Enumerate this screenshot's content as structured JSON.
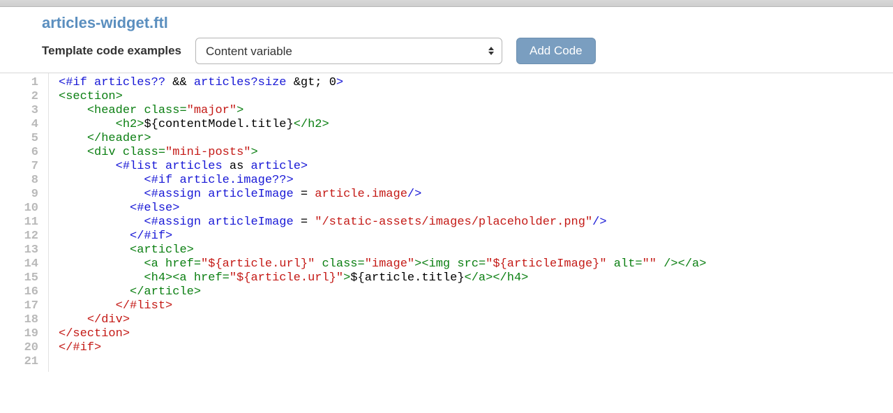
{
  "header": {
    "filename": "articles-widget.ftl",
    "label": "Template code examples",
    "select_value": "Content variable",
    "add_button": "Add Code"
  },
  "code": {
    "line_count": 21,
    "lines": [
      [
        {
          "c": "t-blue",
          "t": "<#if"
        },
        {
          "c": "",
          "t": " "
        },
        {
          "c": "t-blue",
          "t": "articles??"
        },
        {
          "c": "",
          "t": " "
        },
        {
          "c": "t-black",
          "t": "&&"
        },
        {
          "c": "",
          "t": " "
        },
        {
          "c": "t-blue",
          "t": "articles?size"
        },
        {
          "c": "",
          "t": " "
        },
        {
          "c": "t-black",
          "t": "&gt;"
        },
        {
          "c": "",
          "t": " "
        },
        {
          "c": "t-black",
          "t": "0"
        },
        {
          "c": "t-blue",
          "t": ">"
        }
      ],
      [
        {
          "c": "t-green",
          "t": "<section>"
        }
      ],
      [
        {
          "c": "",
          "t": "    "
        },
        {
          "c": "t-green",
          "t": "<header"
        },
        {
          "c": "",
          "t": " "
        },
        {
          "c": "t-green",
          "t": "class="
        },
        {
          "c": "t-red",
          "t": "\"major\""
        },
        {
          "c": "t-green",
          "t": ">"
        }
      ],
      [
        {
          "c": "",
          "t": "        "
        },
        {
          "c": "t-green",
          "t": "<h2>"
        },
        {
          "c": "t-black",
          "t": "${contentModel.title}"
        },
        {
          "c": "t-green",
          "t": "</h2>"
        }
      ],
      [
        {
          "c": "",
          "t": "    "
        },
        {
          "c": "t-green",
          "t": "</header>"
        }
      ],
      [
        {
          "c": "",
          "t": "    "
        },
        {
          "c": "t-green",
          "t": "<div"
        },
        {
          "c": "",
          "t": " "
        },
        {
          "c": "t-green",
          "t": "class="
        },
        {
          "c": "t-red",
          "t": "\"mini-posts\""
        },
        {
          "c": "t-green",
          "t": ">"
        }
      ],
      [
        {
          "c": "",
          "t": "        "
        },
        {
          "c": "t-blue",
          "t": "<#list"
        },
        {
          "c": "",
          "t": " "
        },
        {
          "c": "t-blue",
          "t": "articles"
        },
        {
          "c": "",
          "t": " "
        },
        {
          "c": "t-black",
          "t": "as"
        },
        {
          "c": "",
          "t": " "
        },
        {
          "c": "t-blue",
          "t": "article>"
        }
      ],
      [
        {
          "c": "",
          "t": "            "
        },
        {
          "c": "t-blue",
          "t": "<#if"
        },
        {
          "c": "",
          "t": " "
        },
        {
          "c": "t-blue",
          "t": "article.image??>"
        }
      ],
      [
        {
          "c": "",
          "t": "            "
        },
        {
          "c": "t-blue",
          "t": "<#assign"
        },
        {
          "c": "",
          "t": " "
        },
        {
          "c": "t-blue",
          "t": "articleImage"
        },
        {
          "c": "",
          "t": " "
        },
        {
          "c": "t-black",
          "t": "="
        },
        {
          "c": "",
          "t": " "
        },
        {
          "c": "t-red",
          "t": "article.image"
        },
        {
          "c": "t-blue",
          "t": "/>"
        }
      ],
      [
        {
          "c": "",
          "t": "          "
        },
        {
          "c": "t-blue",
          "t": "<#else>"
        }
      ],
      [
        {
          "c": "",
          "t": "            "
        },
        {
          "c": "t-blue",
          "t": "<#assign"
        },
        {
          "c": "",
          "t": " "
        },
        {
          "c": "t-blue",
          "t": "articleImage"
        },
        {
          "c": "",
          "t": " "
        },
        {
          "c": "t-black",
          "t": "="
        },
        {
          "c": "",
          "t": " "
        },
        {
          "c": "t-red",
          "t": "\"/static-assets/images/placeholder.png\""
        },
        {
          "c": "t-blue",
          "t": "/>"
        }
      ],
      [
        {
          "c": "",
          "t": "          "
        },
        {
          "c": "t-blue",
          "t": "</#if>"
        }
      ],
      [
        {
          "c": "",
          "t": "          "
        },
        {
          "c": "t-green",
          "t": "<article>"
        }
      ],
      [
        {
          "c": "",
          "t": "            "
        },
        {
          "c": "t-green",
          "t": "<a"
        },
        {
          "c": "",
          "t": " "
        },
        {
          "c": "t-green",
          "t": "href="
        },
        {
          "c": "t-red",
          "t": "\"${article.url}\""
        },
        {
          "c": "",
          "t": " "
        },
        {
          "c": "t-green",
          "t": "class="
        },
        {
          "c": "t-red",
          "t": "\"image\""
        },
        {
          "c": "t-green",
          "t": ">"
        },
        {
          "c": "t-green",
          "t": "<img"
        },
        {
          "c": "",
          "t": " "
        },
        {
          "c": "t-green",
          "t": "src="
        },
        {
          "c": "t-red",
          "t": "\"${articleImage}\""
        },
        {
          "c": "",
          "t": " "
        },
        {
          "c": "t-green",
          "t": "alt="
        },
        {
          "c": "t-red",
          "t": "\"\""
        },
        {
          "c": "",
          "t": " "
        },
        {
          "c": "t-green",
          "t": "/></a>"
        }
      ],
      [
        {
          "c": "",
          "t": "            "
        },
        {
          "c": "t-green",
          "t": "<h4><a"
        },
        {
          "c": "",
          "t": " "
        },
        {
          "c": "t-green",
          "t": "href="
        },
        {
          "c": "t-red",
          "t": "\"${article.url}\""
        },
        {
          "c": "t-green",
          "t": ">"
        },
        {
          "c": "t-black",
          "t": "${article.title}"
        },
        {
          "c": "t-green",
          "t": "</a></h4>"
        }
      ],
      [
        {
          "c": "",
          "t": "          "
        },
        {
          "c": "t-green",
          "t": "</article>"
        }
      ],
      [
        {
          "c": "",
          "t": "        "
        },
        {
          "c": "t-red",
          "t": "</#list>"
        }
      ],
      [
        {
          "c": "",
          "t": "    "
        },
        {
          "c": "t-red",
          "t": "</div>"
        }
      ],
      [
        {
          "c": "t-red",
          "t": "</section>"
        }
      ],
      [
        {
          "c": "t-red",
          "t": "</#if>"
        }
      ],
      []
    ]
  }
}
